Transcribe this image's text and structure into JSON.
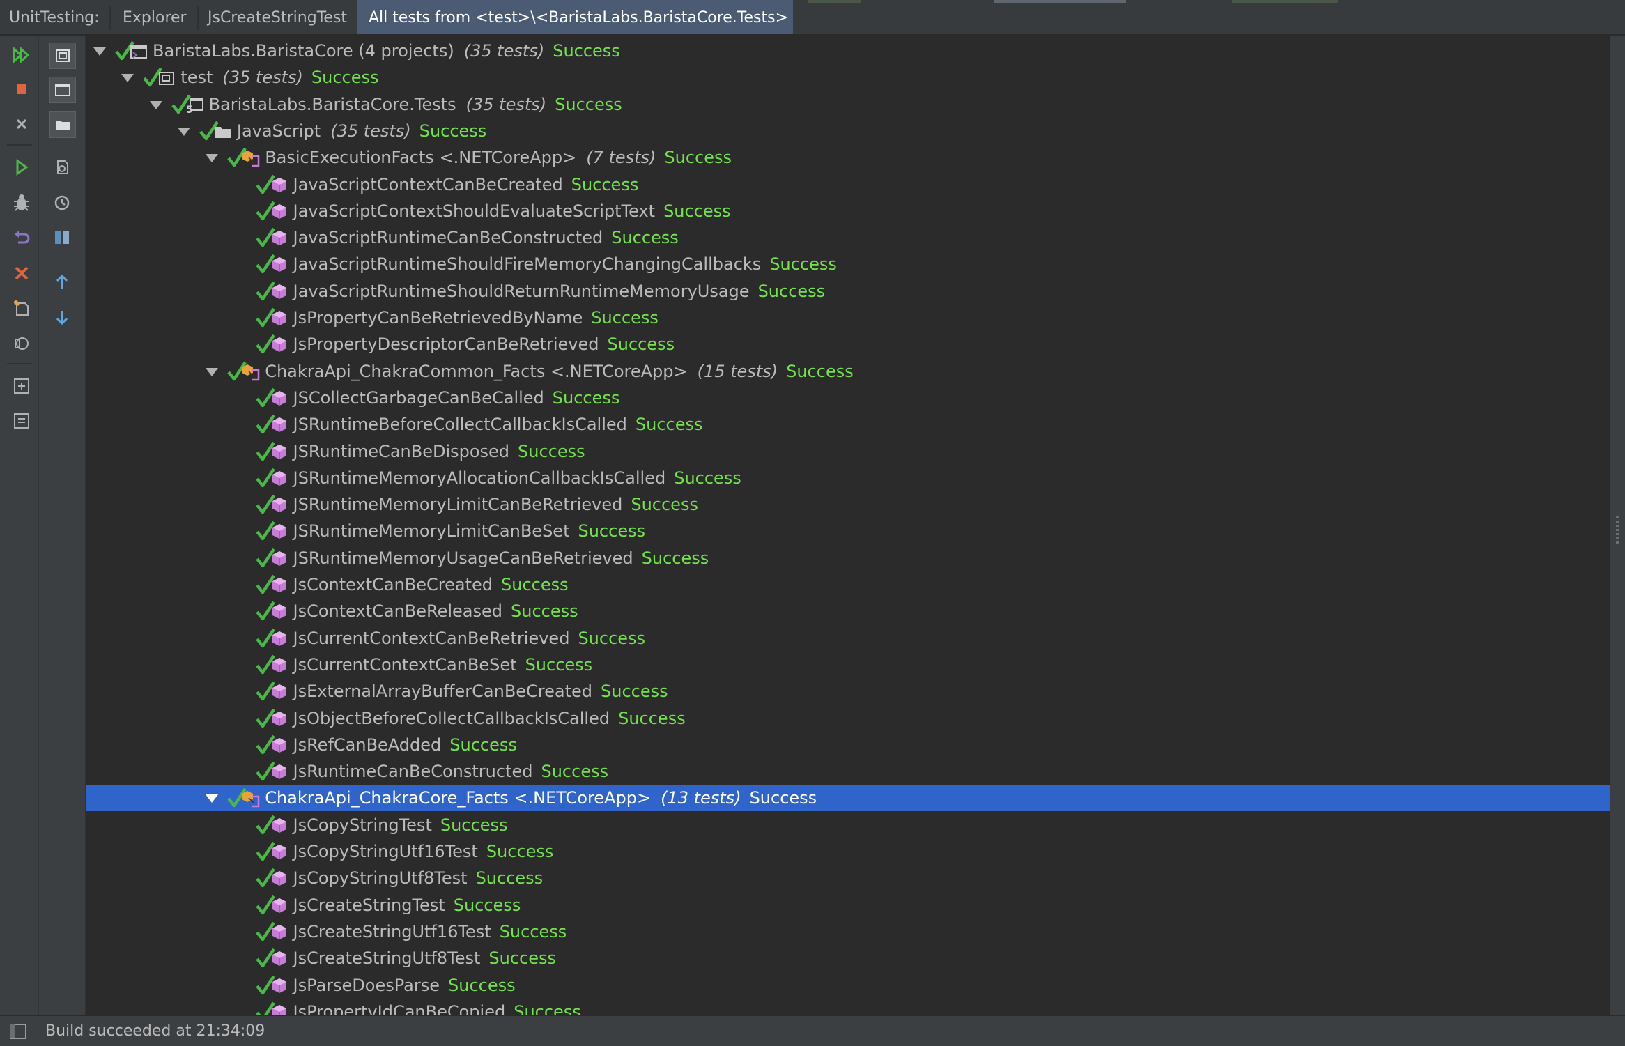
{
  "tabbar": {
    "strip_label": "UnitTesting:",
    "tabs": [
      {
        "label": "Explorer",
        "selected": false
      },
      {
        "label": "JsCreateStringTest",
        "selected": false
      },
      {
        "label": "All tests from <test>\\<BaristaLabs.BaristaCore.Tests>",
        "selected": true
      }
    ]
  },
  "toolbar": {
    "left_column": [
      "run-all-icon",
      "stop-icon",
      "close-icon",
      "run-icon",
      "debug-icon",
      "rerun-icon",
      "delete-icon",
      "new-session-icon",
      "cover-icon",
      "expand-all-icon",
      "collapse-all-icon"
    ],
    "right_column": [
      "session-view-icon",
      "window-icon",
      "folder-view-icon",
      "export-icon",
      "history-icon",
      "split-view-icon",
      "previous-arrow-icon",
      "next-arrow-icon"
    ]
  },
  "colors": {
    "success": "#73e24d",
    "check": "#49b847",
    "selected_row": "#2f65ca",
    "test_icon": "#c77dd8",
    "fixture_icon": "#e8a33d"
  },
  "tree": {
    "nodes": [
      {
        "depth": 0,
        "kind": "solution",
        "expanded": true,
        "label": "BaristaLabs.BaristaCore (4 projects)",
        "count": "(35 tests)",
        "status": "Success"
      },
      {
        "depth": 1,
        "kind": "folder-solution",
        "expanded": true,
        "label": "test",
        "count": "(35 tests)",
        "status": "Success"
      },
      {
        "depth": 2,
        "kind": "project",
        "expanded": true,
        "label": "BaristaLabs.BaristaCore.Tests",
        "count": "(35 tests)",
        "status": "Success"
      },
      {
        "depth": 3,
        "kind": "folder",
        "expanded": true,
        "label": "JavaScript",
        "count": "(35 tests)",
        "status": "Success"
      },
      {
        "depth": 4,
        "kind": "fixture",
        "expanded": true,
        "label": "BasicExecutionFacts <.NETCoreApp>",
        "count": "(7 tests)",
        "status": "Success"
      },
      {
        "depth": 5,
        "kind": "test",
        "label": "JavaScriptContextCanBeCreated",
        "status": "Success"
      },
      {
        "depth": 5,
        "kind": "test",
        "label": "JavaScriptContextShouldEvaluateScriptText",
        "status": "Success"
      },
      {
        "depth": 5,
        "kind": "test",
        "label": "JavaScriptRuntimeCanBeConstructed",
        "status": "Success"
      },
      {
        "depth": 5,
        "kind": "test",
        "label": "JavaScriptRuntimeShouldFireMemoryChangingCallbacks",
        "status": "Success"
      },
      {
        "depth": 5,
        "kind": "test",
        "label": "JavaScriptRuntimeShouldReturnRuntimeMemoryUsage",
        "status": "Success"
      },
      {
        "depth": 5,
        "kind": "test",
        "label": "JsPropertyCanBeRetrievedByName",
        "status": "Success"
      },
      {
        "depth": 5,
        "kind": "test",
        "label": "JsPropertyDescriptorCanBeRetrieved",
        "status": "Success"
      },
      {
        "depth": 4,
        "kind": "fixture",
        "expanded": true,
        "label": "ChakraApi_ChakraCommon_Facts <.NETCoreApp>",
        "count": "(15 tests)",
        "status": "Success"
      },
      {
        "depth": 5,
        "kind": "test",
        "label": "JSCollectGarbageCanBeCalled",
        "status": "Success"
      },
      {
        "depth": 5,
        "kind": "test",
        "label": "JSRuntimeBeforeCollectCallbackIsCalled",
        "status": "Success"
      },
      {
        "depth": 5,
        "kind": "test",
        "label": "JSRuntimeCanBeDisposed",
        "status": "Success"
      },
      {
        "depth": 5,
        "kind": "test",
        "label": "JSRuntimeMemoryAllocationCallbackIsCalled",
        "status": "Success"
      },
      {
        "depth": 5,
        "kind": "test",
        "label": "JSRuntimeMemoryLimitCanBeRetrieved",
        "status": "Success"
      },
      {
        "depth": 5,
        "kind": "test",
        "label": "JSRuntimeMemoryLimitCanBeSet",
        "status": "Success"
      },
      {
        "depth": 5,
        "kind": "test",
        "label": "JSRuntimeMemoryUsageCanBeRetrieved",
        "status": "Success"
      },
      {
        "depth": 5,
        "kind": "test",
        "label": "JsContextCanBeCreated",
        "status": "Success"
      },
      {
        "depth": 5,
        "kind": "test",
        "label": "JsContextCanBeReleased",
        "status": "Success"
      },
      {
        "depth": 5,
        "kind": "test",
        "label": "JsCurrentContextCanBeRetrieved",
        "status": "Success"
      },
      {
        "depth": 5,
        "kind": "test",
        "label": "JsCurrentContextCanBeSet",
        "status": "Success"
      },
      {
        "depth": 5,
        "kind": "test",
        "label": "JsExternalArrayBufferCanBeCreated",
        "status": "Success"
      },
      {
        "depth": 5,
        "kind": "test",
        "label": "JsObjectBeforeCollectCallbackIsCalled",
        "status": "Success"
      },
      {
        "depth": 5,
        "kind": "test",
        "label": "JsRefCanBeAdded",
        "status": "Success"
      },
      {
        "depth": 5,
        "kind": "test",
        "label": "JsRuntimeCanBeConstructed",
        "status": "Success"
      },
      {
        "depth": 4,
        "kind": "fixture",
        "expanded": true,
        "selected": true,
        "label": "ChakraApi_ChakraCore_Facts <.NETCoreApp>",
        "count": "(13 tests)",
        "status": "Success"
      },
      {
        "depth": 5,
        "kind": "test",
        "label": "JsCopyStringTest",
        "status": "Success"
      },
      {
        "depth": 5,
        "kind": "test",
        "label": "JsCopyStringUtf16Test",
        "status": "Success"
      },
      {
        "depth": 5,
        "kind": "test",
        "label": "JsCopyStringUtf8Test",
        "status": "Success"
      },
      {
        "depth": 5,
        "kind": "test",
        "label": "JsCreateStringTest",
        "status": "Success"
      },
      {
        "depth": 5,
        "kind": "test",
        "label": "JsCreateStringUtf16Test",
        "status": "Success"
      },
      {
        "depth": 5,
        "kind": "test",
        "label": "JsCreateStringUtf8Test",
        "status": "Success"
      },
      {
        "depth": 5,
        "kind": "test",
        "label": "JsParseDoesParse",
        "status": "Success"
      },
      {
        "depth": 5,
        "kind": "test",
        "label": "JsPropertyIdCanBeCopied",
        "status": "Success"
      }
    ]
  },
  "statusbar": {
    "icon": "panel-toggle-icon",
    "text": "Build succeeded at 21:34:09"
  }
}
